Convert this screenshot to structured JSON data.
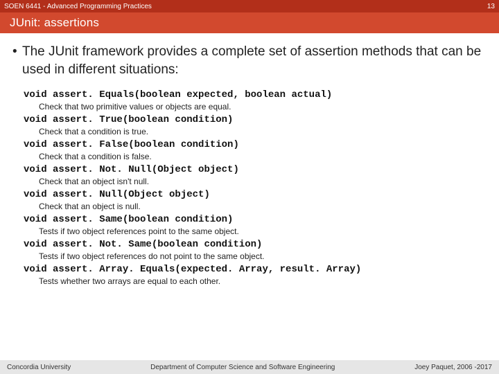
{
  "header": {
    "course": "SOEN 6441 - Advanced Programming Practices",
    "page_number": "13"
  },
  "title": "JUnit: assertions",
  "intro": "The JUnit framework provides a complete set of assertion methods that can be used in different situations:",
  "methods": [
    {
      "sig": "void assert. Equals(boolean expected, boolean actual)",
      "desc": "Check that two primitive values or objects are equal."
    },
    {
      "sig": "void assert. True(boolean condition)",
      "desc": "Check that a condition is true."
    },
    {
      "sig": "void assert. False(boolean condition)",
      "desc": "Check that a condition is false."
    },
    {
      "sig": "void assert. Not. Null(Object object)",
      "desc": "Check that an object isn't null."
    },
    {
      "sig": "void assert. Null(Object object)",
      "desc": "Check that an object is null."
    },
    {
      "sig": "void assert. Same(boolean condition)",
      "desc": "Tests if two object references point to the same object."
    },
    {
      "sig": "void assert. Not. Same(boolean condition)",
      "desc": "Tests if two object references do not point to the same object."
    },
    {
      "sig": "void assert. Array. Equals(expected. Array, result. Array)",
      "desc": "Tests whether two arrays are equal to each other."
    }
  ],
  "footer": {
    "left": "Concordia University",
    "center": "Department of Computer Science and Software Engineering",
    "right": "Joey Paquet, 2006 -2017"
  }
}
